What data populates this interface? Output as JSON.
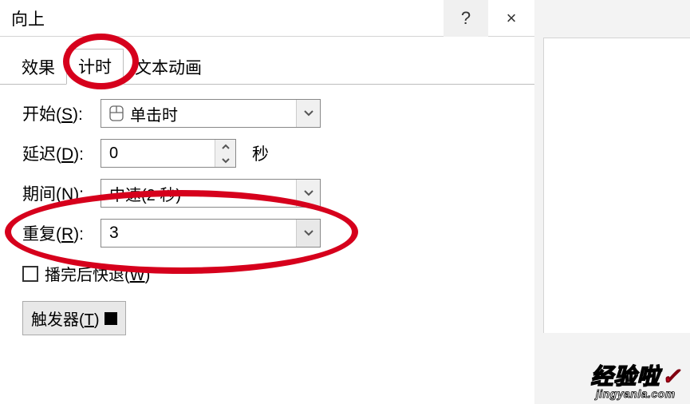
{
  "dialog": {
    "title": "向上",
    "help": "?",
    "close": "×"
  },
  "tabs": {
    "effect": "效果",
    "timing": "计时",
    "textAnim": "文本动画"
  },
  "form": {
    "start": {
      "label_pre": "开始(",
      "label_u": "S",
      "label_post": "):",
      "value": "单击时"
    },
    "delay": {
      "label_pre": "延迟(",
      "label_u": "D",
      "label_post": "):",
      "value": "0",
      "unit": "秒"
    },
    "duration": {
      "label_pre": "期间(",
      "label_u": "N",
      "label_post": "):",
      "value": "中速(2 秒)"
    },
    "repeat": {
      "label_pre": "重复(",
      "label_u": "R",
      "label_post": "):",
      "value": "3"
    },
    "rewind": {
      "label_pre": "播完后快退(",
      "label_u": "W",
      "label_post": ")"
    },
    "trigger": {
      "label_pre": "触发器(",
      "label_u": "T",
      "label_post": ")"
    }
  },
  "watermark": {
    "cn": "经验啦",
    "check": "✓",
    "en": "jingyanla.com"
  }
}
